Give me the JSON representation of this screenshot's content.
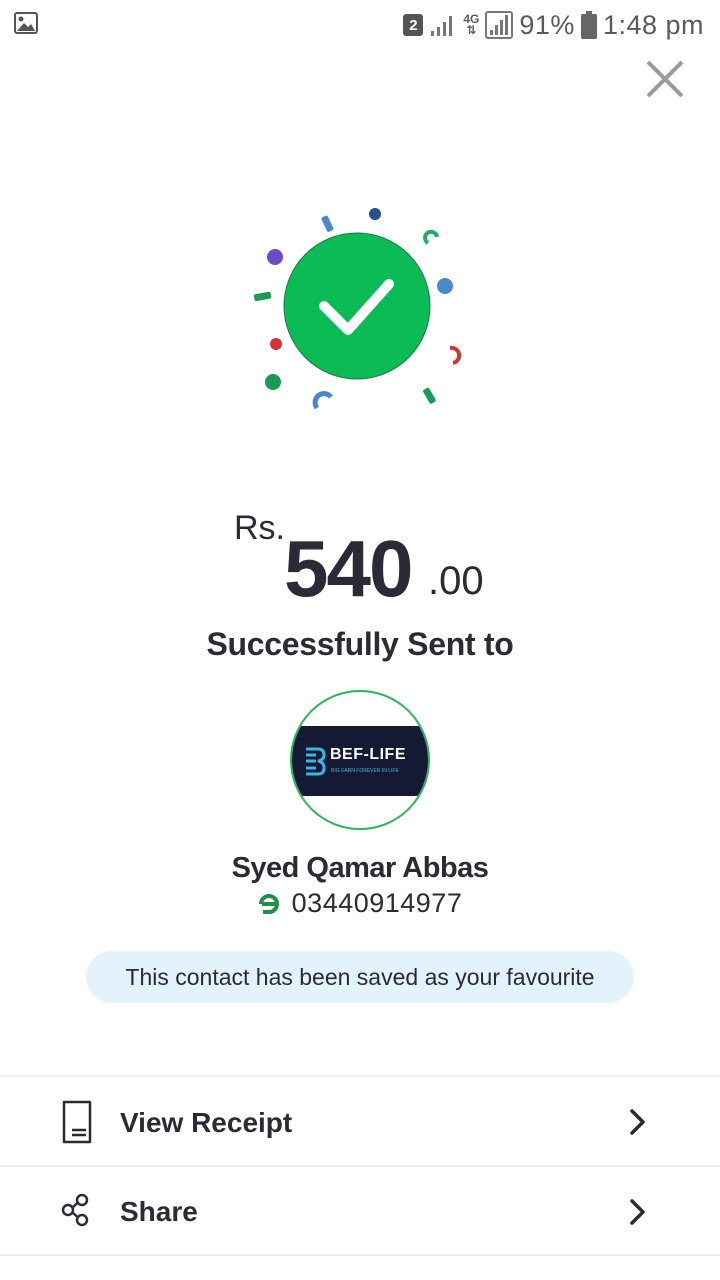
{
  "status_bar": {
    "sim_slot": "2",
    "network": "4G",
    "battery": "91%",
    "time": "1:48 pm",
    "icons": [
      "gallery-icon",
      "sim-icon",
      "signal-icon",
      "network-4g-icon",
      "signal-icon",
      "battery-icon"
    ]
  },
  "header": {
    "close_icon": "close-icon"
  },
  "success": {
    "icon": "check-icon",
    "color": "#0bbb55"
  },
  "amount": {
    "currency": "Rs.",
    "whole": "540",
    "decimal": ".00"
  },
  "title": "Successfully Sent to",
  "recipient": {
    "logo_name": "BEF-LIFE",
    "logo_tagline": "BIG EARN FOREVER IN LIFE",
    "name": "Syed Qamar Abbas",
    "phone": "03440914977",
    "wallet_icon": "easypaisa-icon"
  },
  "favourite_notice": "This contact has been saved as your favourite",
  "actions": [
    {
      "label": "View Receipt",
      "icon": "receipt-icon"
    },
    {
      "label": "Share",
      "icon": "share-icon"
    }
  ],
  "colors": {
    "text": "#2b2a35",
    "accent_green": "#0bbb55",
    "banner_bg": "#e3f3fb"
  }
}
